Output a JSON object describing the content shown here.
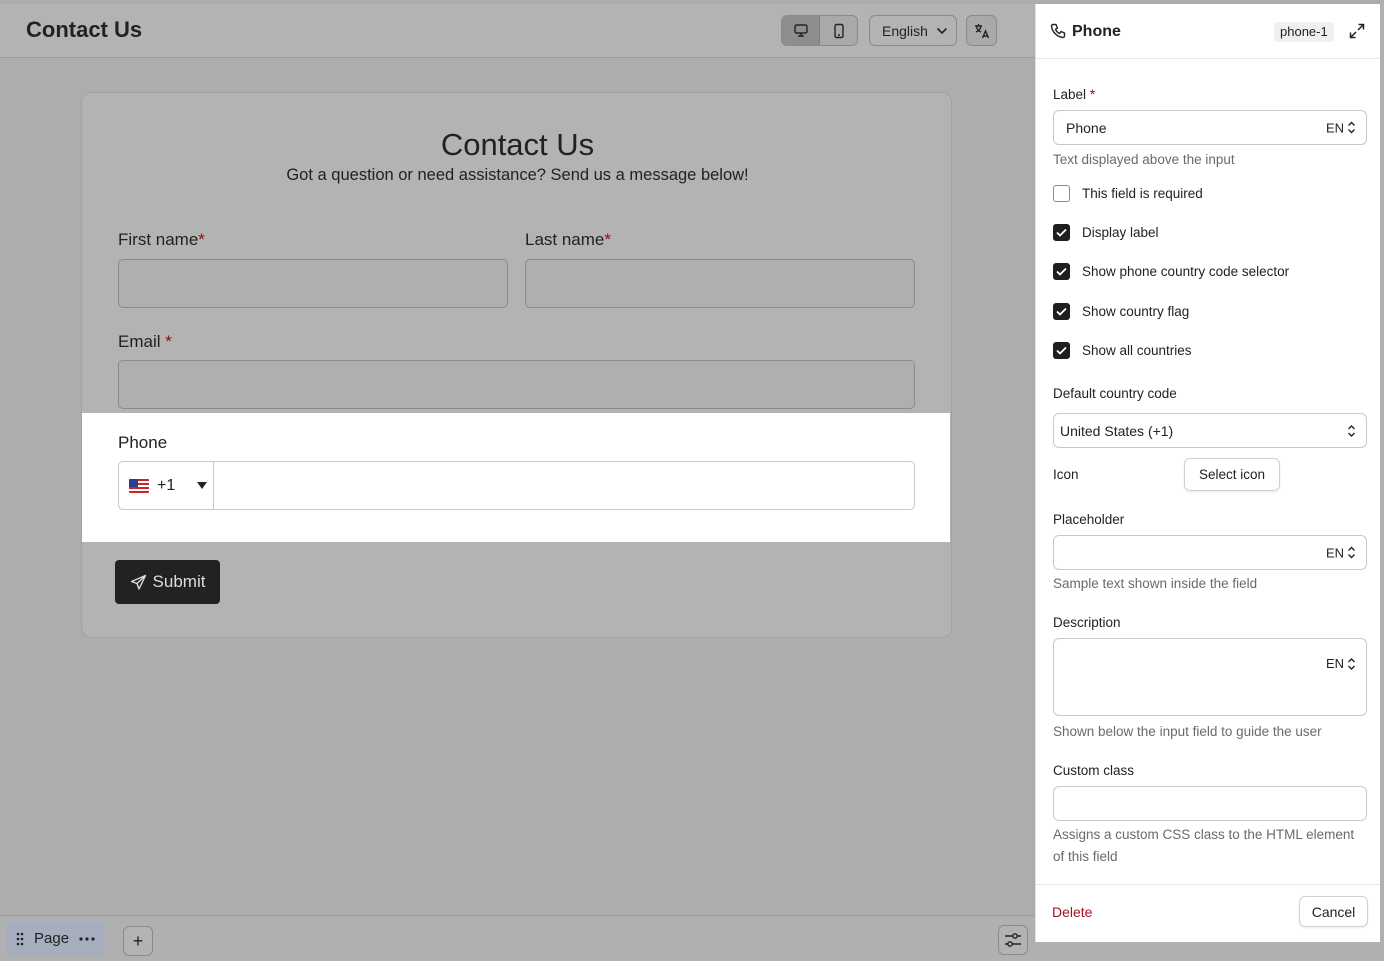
{
  "topbar": {
    "title": "Contact Us",
    "language": "English"
  },
  "form": {
    "title": "Contact Us",
    "subtitle": "Got a question or need assistance? Send us a message below!",
    "first_name_label": "First name",
    "last_name_label": "Last name",
    "email_label": "Email",
    "required_mark": "*",
    "phone_label": "Phone",
    "phone_code": "+1",
    "submit_label": "Submit"
  },
  "bottombar": {
    "page_label": "Page",
    "add_symbol": "+"
  },
  "panel": {
    "title": "Phone",
    "field_id": "phone-1",
    "label_title": "Label",
    "label_required_mark": "*",
    "label_value": "Phone",
    "lang_tag": "EN",
    "label_help": "Text displayed above the input",
    "checkboxes": [
      {
        "label": "This field is required",
        "checked": false
      },
      {
        "label": "Display label",
        "checked": true
      },
      {
        "label": "Show phone country code selector",
        "checked": true
      },
      {
        "label": "Show country flag",
        "checked": true
      },
      {
        "label": "Show all countries",
        "checked": true
      }
    ],
    "default_country_title": "Default country code",
    "default_country_value": "United States (+1)",
    "icon_title": "Icon",
    "select_icon_label": "Select icon",
    "placeholder_title": "Placeholder",
    "placeholder_help": "Sample text shown inside the field",
    "description_title": "Description",
    "description_help": "Shown below the input field to guide the user",
    "custom_class_title": "Custom class",
    "custom_class_help_1": "Assigns a custom CSS class to the HTML element",
    "custom_class_help_2": "of this field",
    "delete_label": "Delete",
    "cancel_label": "Cancel"
  },
  "colors": {
    "accent_dark": "#1f1f1f",
    "required_red": "#8a0f0f",
    "delete_red": "#a3121e"
  }
}
